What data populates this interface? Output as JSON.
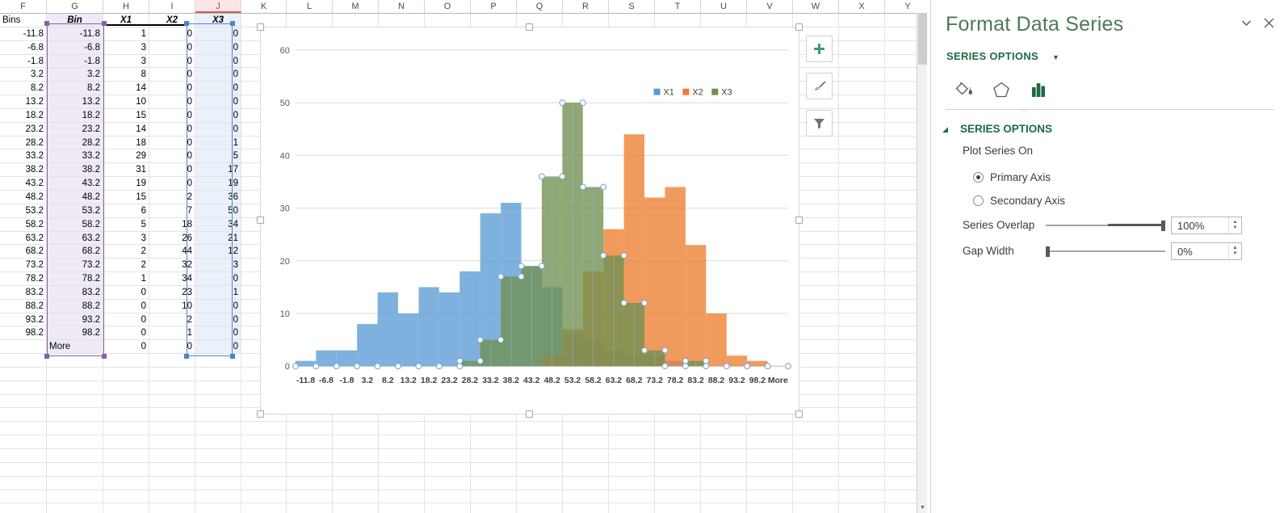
{
  "sheet": {
    "columns": [
      "F",
      "G",
      "H",
      "I",
      "J",
      "K",
      "L",
      "M",
      "N",
      "O",
      "P",
      "Q",
      "R",
      "S",
      "T",
      "U",
      "V",
      "W",
      "X",
      "Y"
    ],
    "selected_column": "J",
    "headers": [
      "Bins",
      "Bin",
      "X1",
      "X2",
      "X3"
    ],
    "rows": [
      {
        "bins": "-11.8",
        "bin": "-11.8",
        "x1": "1",
        "x2": "0",
        "x3": "0"
      },
      {
        "bins": "-6.8",
        "bin": "-6.8",
        "x1": "3",
        "x2": "0",
        "x3": "0"
      },
      {
        "bins": "-1.8",
        "bin": "-1.8",
        "x1": "3",
        "x2": "0",
        "x3": "0"
      },
      {
        "bins": "3.2",
        "bin": "3.2",
        "x1": "8",
        "x2": "0",
        "x3": "0"
      },
      {
        "bins": "8.2",
        "bin": "8.2",
        "x1": "14",
        "x2": "0",
        "x3": "0"
      },
      {
        "bins": "13.2",
        "bin": "13.2",
        "x1": "10",
        "x2": "0",
        "x3": "0"
      },
      {
        "bins": "18.2",
        "bin": "18.2",
        "x1": "15",
        "x2": "0",
        "x3": "0"
      },
      {
        "bins": "23.2",
        "bin": "23.2",
        "x1": "14",
        "x2": "0",
        "x3": "0"
      },
      {
        "bins": "28.2",
        "bin": "28.2",
        "x1": "18",
        "x2": "0",
        "x3": "1"
      },
      {
        "bins": "33.2",
        "bin": "33.2",
        "x1": "29",
        "x2": "0",
        "x3": "5"
      },
      {
        "bins": "38.2",
        "bin": "38.2",
        "x1": "31",
        "x2": "0",
        "x3": "17"
      },
      {
        "bins": "43.2",
        "bin": "43.2",
        "x1": "19",
        "x2": "0",
        "x3": "19"
      },
      {
        "bins": "48.2",
        "bin": "48.2",
        "x1": "15",
        "x2": "2",
        "x3": "36"
      },
      {
        "bins": "53.2",
        "bin": "53.2",
        "x1": "6",
        "x2": "7",
        "x3": "50"
      },
      {
        "bins": "58.2",
        "bin": "58.2",
        "x1": "5",
        "x2": "18",
        "x3": "34"
      },
      {
        "bins": "63.2",
        "bin": "63.2",
        "x1": "3",
        "x2": "26",
        "x3": "21"
      },
      {
        "bins": "68.2",
        "bin": "68.2",
        "x1": "2",
        "x2": "44",
        "x3": "12"
      },
      {
        "bins": "73.2",
        "bin": "73.2",
        "x1": "2",
        "x2": "32",
        "x3": "3"
      },
      {
        "bins": "78.2",
        "bin": "78.2",
        "x1": "1",
        "x2": "34",
        "x3": "0"
      },
      {
        "bins": "83.2",
        "bin": "83.2",
        "x1": "0",
        "x2": "23",
        "x3": "1"
      },
      {
        "bins": "88.2",
        "bin": "88.2",
        "x1": "0",
        "x2": "10",
        "x3": "0"
      },
      {
        "bins": "93.2",
        "bin": "93.2",
        "x1": "0",
        "x2": "2",
        "x3": "0"
      },
      {
        "bins": "98.2",
        "bin": "98.2",
        "x1": "0",
        "x2": "1",
        "x3": "0"
      },
      {
        "bins": "",
        "bin": "More",
        "x1": "0",
        "x2": "0",
        "x3": "0"
      }
    ]
  },
  "chart_data": {
    "type": "bar",
    "title": "",
    "xlabel": "",
    "ylabel": "",
    "ylim": [
      0,
      60
    ],
    "yticks": [
      0,
      10,
      20,
      30,
      40,
      50,
      60
    ],
    "grid": true,
    "legend_position": "top-right",
    "gap_width_percent": 0,
    "series_overlap_percent": 100,
    "categories": [
      "-11.8",
      "-6.8",
      "-1.8",
      "3.2",
      "8.2",
      "13.2",
      "18.2",
      "23.2",
      "28.2",
      "33.2",
      "38.2",
      "43.2",
      "48.2",
      "53.2",
      "58.2",
      "63.2",
      "68.2",
      "73.2",
      "78.2",
      "83.2",
      "88.2",
      "93.2",
      "98.2",
      "More"
    ],
    "series": [
      {
        "name": "X1",
        "color": "#5B9BD5",
        "values": [
          1,
          3,
          3,
          8,
          14,
          10,
          15,
          14,
          18,
          29,
          31,
          19,
          15,
          6,
          5,
          3,
          2,
          2,
          1,
          0,
          0,
          0,
          0,
          0
        ]
      },
      {
        "name": "X2",
        "color": "#ED7D31",
        "values": [
          0,
          0,
          0,
          0,
          0,
          0,
          0,
          0,
          0,
          0,
          0,
          0,
          2,
          7,
          18,
          26,
          44,
          32,
          34,
          23,
          10,
          2,
          1,
          0
        ]
      },
      {
        "name": "X3",
        "color": "#70904F",
        "values": [
          0,
          0,
          0,
          0,
          0,
          0,
          0,
          0,
          1,
          5,
          17,
          19,
          36,
          50,
          34,
          21,
          12,
          3,
          0,
          1,
          0,
          0,
          0,
          0
        ],
        "selected": true
      }
    ]
  },
  "chart_buttons": [
    {
      "name": "chart-elements-button",
      "icon": "plus-icon"
    },
    {
      "name": "chart-styles-button",
      "icon": "brush-icon"
    },
    {
      "name": "chart-filters-button",
      "icon": "funnel-icon"
    }
  ],
  "pane": {
    "title": "Format Data Series",
    "dropdown_icon": "chevron-down-icon",
    "close_icon": "close-icon",
    "subtitle": "SERIES OPTIONS",
    "subtitle_caret": "chevron-down-icon",
    "tabs": [
      {
        "name": "fill-line-tab",
        "icon": "paint-bucket-icon",
        "active": false
      },
      {
        "name": "effects-tab",
        "icon": "pentagon-icon",
        "active": false
      },
      {
        "name": "series-options-tab",
        "icon": "bar-chart-icon",
        "active": true
      }
    ],
    "section_header": "SERIES OPTIONS",
    "plot_series_on_label": "Plot Series On",
    "radios": [
      {
        "label": "Primary Axis",
        "accesskey": "P",
        "checked": true
      },
      {
        "label": "Secondary Axis",
        "accesskey": "S",
        "checked": false
      }
    ],
    "series_overlap": {
      "label": "Series Overlap",
      "accesskey": "O",
      "value": "100%",
      "slider_percent": 100
    },
    "gap_width": {
      "label": "Gap Width",
      "accesskey": "W",
      "value": "0%",
      "slider_percent": 0
    }
  },
  "colors": {
    "accent_green": "#1e6b43",
    "title_green": "#4a7a57",
    "series_blue": "#5B9BD5",
    "series_orange": "#ED7D31",
    "series_green": "#70904F",
    "selection_purple": "#8064a2",
    "selection_blue": "#4a86c8"
  }
}
